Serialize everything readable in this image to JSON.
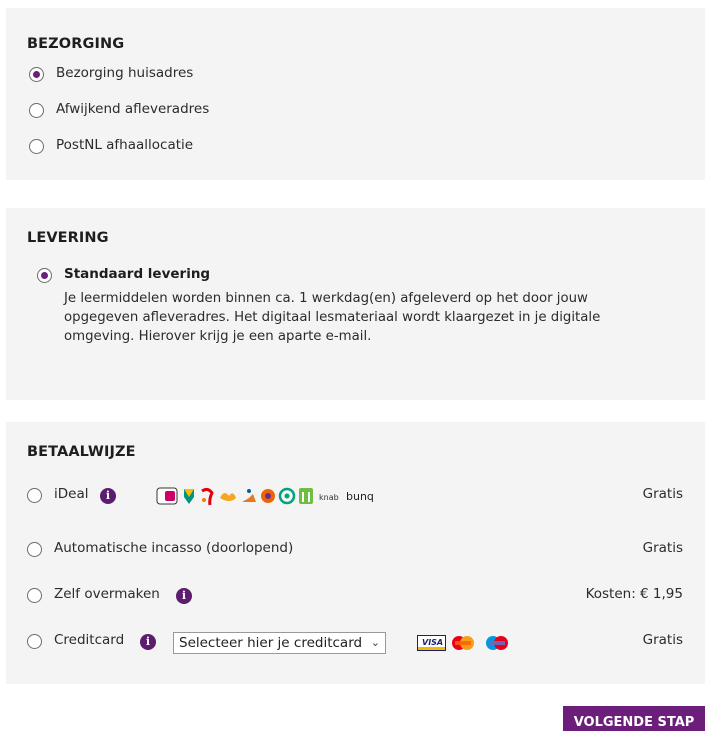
{
  "delivery": {
    "title": "BEZORGING",
    "options": [
      {
        "label": "Bezorging huisadres",
        "selected": true
      },
      {
        "label": "Afwijkend afleveradres",
        "selected": false
      },
      {
        "label": "PostNL afhaallocatie",
        "selected": false
      }
    ]
  },
  "shipping": {
    "title": "LEVERING",
    "option_label": "Standaard levering",
    "description": "Je leermiddelen worden binnen ca. 1 werkdag(en) afgeleverd op het door jouw opgegeven afleveradres. Het digitaal lesmateriaal wordt klaargezet in je digitale omgeving. Hierover krijg je een aparte e-mail."
  },
  "payment": {
    "title": "BETAALWIJZE",
    "options": [
      {
        "label": "iDeal",
        "price": "Gratis"
      },
      {
        "label": "Automatische incasso (doorlopend)",
        "price": "Gratis"
      },
      {
        "label": "Zelf overmaken",
        "price": "Kosten: € 1,95"
      },
      {
        "label": "Creditcard",
        "price": "Gratis"
      }
    ],
    "creditcard_select": "Selecteer hier je creditcard",
    "bank_logos": [
      "ideal-logo",
      "abn-amro-logo",
      "rabobank-logo",
      "sns-logo",
      "asn-logo",
      "triodos-logo",
      "regiobank-logo",
      "ing-logo",
      "knab-logo",
      "bunq-logo"
    ],
    "bank_text": {
      "knab": "knab",
      "bunq": "bunq"
    },
    "card_logos": [
      "visa-logo",
      "mastercard-logo",
      "maestro-logo"
    ],
    "card_text": {
      "visa": "VISA"
    }
  },
  "next_button": "VOLGENDE STAP",
  "colors": {
    "accent": "#6c1f7a",
    "panel": "#f4f4f4",
    "info": "#5c1d6e"
  }
}
